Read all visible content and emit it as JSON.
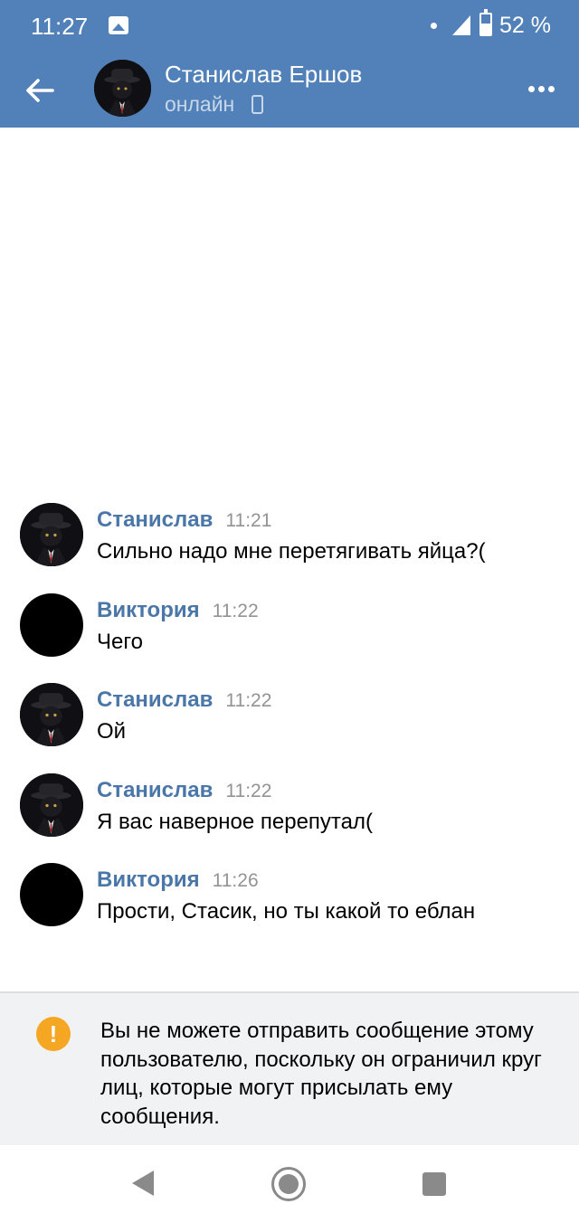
{
  "status_bar": {
    "time": "11:27",
    "battery": "52 %"
  },
  "header": {
    "name": "Станислав Ершов",
    "status": "онлайн",
    "back_icon": "arrow-left-icon",
    "more_icon": "more-dots-icon"
  },
  "messages": [
    {
      "author": "Станислав",
      "time": "11:21",
      "text": "Сильно надо мне перетягивать яйца?(",
      "avatar": "photo"
    },
    {
      "author": "Виктория",
      "time": "11:22",
      "text": "Чего",
      "avatar": "black"
    },
    {
      "author": "Станислав",
      "time": "11:22",
      "text": "Ой",
      "avatar": "photo"
    },
    {
      "author": "Станислав",
      "time": "11:22",
      "text": "Я вас наверное перепутал(",
      "avatar": "photo"
    },
    {
      "author": "Виктория",
      "time": "11:26",
      "text": "Прости, Стасик, но ты какой то еблан",
      "avatar": "black"
    }
  ],
  "notice": {
    "icon": "warning-icon",
    "icon_glyph": "!",
    "text": "Вы не можете отправить сообщение этому пользователю, поскольку он ограничил круг лиц, которые могут присылать ему сообщения."
  },
  "colors": {
    "header": "#5181b8",
    "author": "#4a76a8",
    "warning": "#f5a623"
  }
}
